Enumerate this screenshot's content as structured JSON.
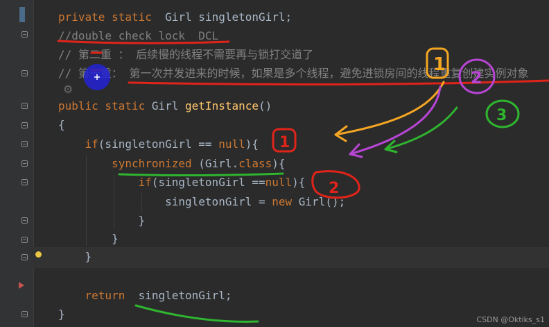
{
  "editor": {
    "lines": [
      {
        "id": "field",
        "segments": [
          {
            "text": "private static ",
            "cls": "kw"
          },
          {
            "text": " Girl singletonGirl;",
            "cls": ""
          }
        ]
      },
      {
        "id": "comment-dcl",
        "segments": [
          {
            "text": "//double check lock  DCL",
            "cls": "cm"
          }
        ]
      },
      {
        "id": "comment-second",
        "segments": [
          {
            "text": "// 第二重 ： 后续慢的线程不需要再与锁打交道了",
            "cls": "cm"
          }
        ]
      },
      {
        "id": "comment-first",
        "segments": [
          {
            "text": "// 第一重： 第一次并发进来的时候，如果是多个线程，避免进锁房间的线程重复创建实例对象",
            "cls": "cm"
          }
        ]
      },
      {
        "id": "method-sig",
        "segments": [
          {
            "text": "public static ",
            "cls": "kw"
          },
          {
            "text": "Girl ",
            "cls": ""
          },
          {
            "text": "getInstance",
            "cls": "fn"
          },
          {
            "text": "()",
            "cls": ""
          }
        ]
      },
      {
        "id": "open-brace",
        "segments": [
          {
            "text": "{",
            "cls": ""
          }
        ]
      },
      {
        "id": "if-outer",
        "segments": [
          {
            "text": "    if",
            "cls": "kw"
          },
          {
            "text": "(singletonGirl == ",
            "cls": ""
          },
          {
            "text": "null",
            "cls": "kw"
          },
          {
            "text": "){",
            "cls": ""
          }
        ]
      },
      {
        "id": "sync",
        "segments": [
          {
            "text": "        synchronized ",
            "cls": "kw"
          },
          {
            "text": "(Girl.",
            "cls": ""
          },
          {
            "text": "class",
            "cls": "kw"
          },
          {
            "text": "){",
            "cls": ""
          }
        ]
      },
      {
        "id": "if-inner",
        "segments": [
          {
            "text": "            if",
            "cls": "kw"
          },
          {
            "text": "(singletonGirl ==",
            "cls": ""
          },
          {
            "text": "null",
            "cls": "kw"
          },
          {
            "text": "){",
            "cls": ""
          }
        ]
      },
      {
        "id": "assign",
        "segments": [
          {
            "text": "                singletonGirl = ",
            "cls": ""
          },
          {
            "text": "new ",
            "cls": "kw"
          },
          {
            "text": "Girl();",
            "cls": ""
          }
        ]
      },
      {
        "id": "close-inner",
        "segments": [
          {
            "text": "            }",
            "cls": ""
          }
        ]
      },
      {
        "id": "close-sync",
        "segments": [
          {
            "text": "        }",
            "cls": ""
          }
        ]
      },
      {
        "id": "close-outer",
        "segments": [
          {
            "text": "    }",
            "cls": ""
          }
        ]
      },
      {
        "id": "blank",
        "segments": [
          {
            "text": "",
            "cls": ""
          }
        ]
      },
      {
        "id": "return",
        "segments": [
          {
            "text": "    return ",
            "cls": "kw"
          },
          {
            "text": " singletonGirl;",
            "cls": ""
          }
        ]
      },
      {
        "id": "close-method",
        "segments": [
          {
            "text": "}",
            "cls": ""
          }
        ]
      }
    ]
  },
  "annotations": {
    "label_1": "1",
    "label_2": "2",
    "label_3": "3",
    "box_1": "1",
    "box_2": "2",
    "colors": {
      "red": "#e0241a",
      "orange": "#f5a623",
      "purple": "#b845d6",
      "green": "#2fb52f"
    }
  },
  "watermark": "CSDN @Oktiks_s1",
  "colors": {
    "background": "#2b2b2b",
    "keyword": "#cc7832",
    "method": "#ffc66d",
    "comment": "#808080",
    "text": "#a9b7c6"
  }
}
